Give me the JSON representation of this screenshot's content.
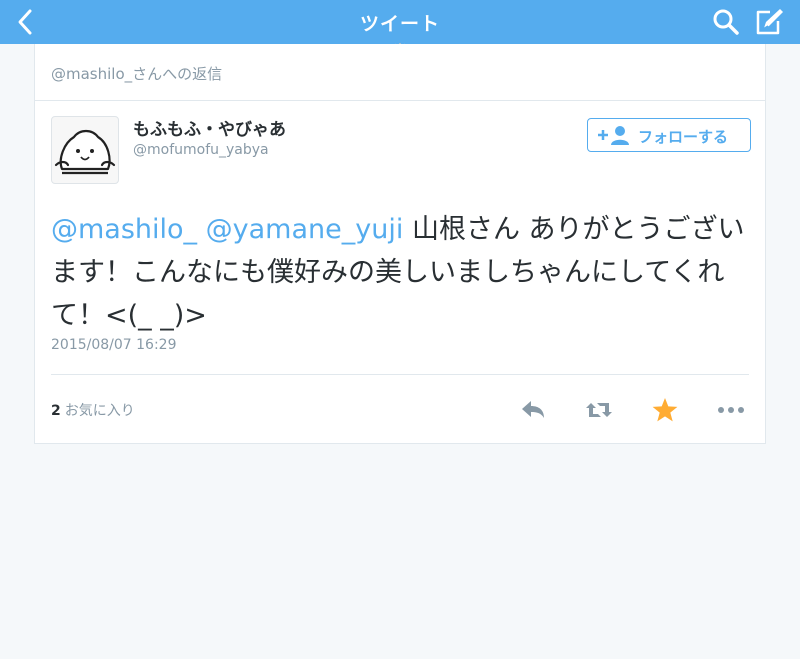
{
  "nav": {
    "title": "ツイート",
    "back_icon": "chevron-left-icon",
    "search_icon": "search-icon",
    "compose_icon": "compose-icon",
    "bar_color": "#55acee"
  },
  "tweet": {
    "reply_context": "@mashilo_さんへの返信",
    "author": {
      "display_name": "もふもふ・やびゃあ",
      "screen_name": "@mofumofu_yabya"
    },
    "follow_button": "フォローする",
    "mentions": [
      "@mashilo_",
      "@yamane_yuji"
    ],
    "text": "山根さん ありがとうございます！こんなにも僕好みの美しいましちゃんにしてくれて！<(_ _)>",
    "timestamp": "2015/08/07 16:29",
    "favorites_count": "2",
    "favorites_label": "お気に入り",
    "actions": [
      "reply-icon",
      "retweet-icon",
      "favorite-icon",
      "more-icon"
    ],
    "favorite_color": "#ffac33"
  }
}
